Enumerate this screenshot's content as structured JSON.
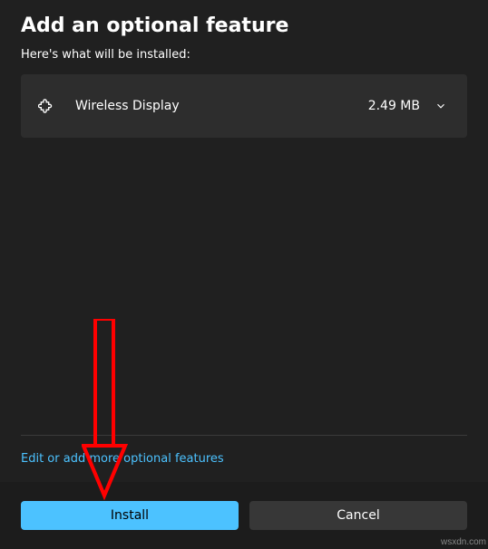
{
  "dialog": {
    "title": "Add an optional feature",
    "subtitle": "Here's what will be installed:"
  },
  "features": [
    {
      "name": "Wireless Display",
      "size": "2.49 MB"
    }
  ],
  "link": {
    "edit_more": "Edit or add more optional features"
  },
  "buttons": {
    "install": "Install",
    "cancel": "Cancel"
  },
  "watermark": "wsxdn.com"
}
